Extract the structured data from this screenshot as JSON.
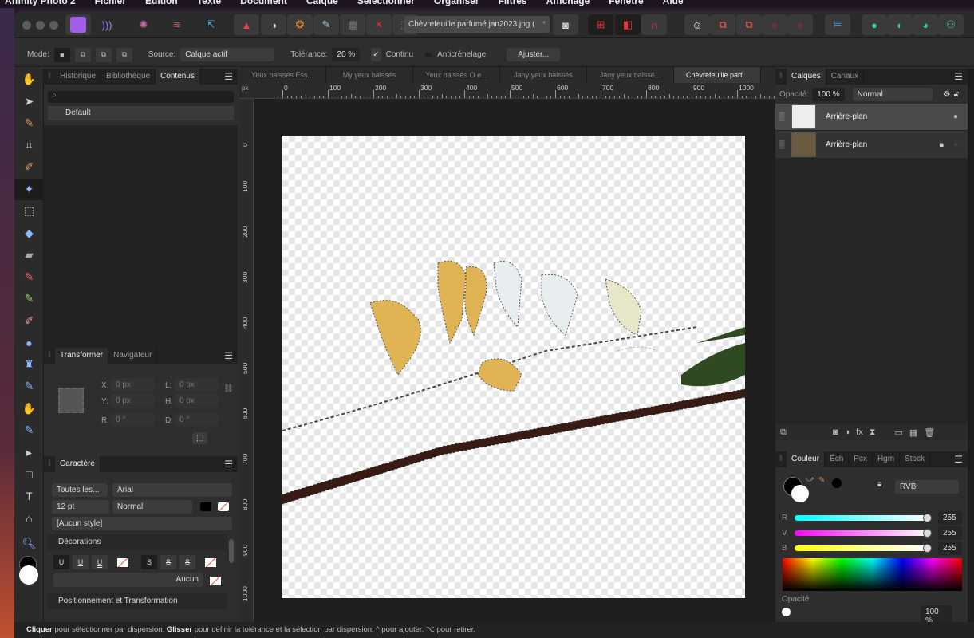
{
  "menubar": [
    "Affinity Photo 2",
    "Fichier",
    "Édition",
    "Texte",
    "Document",
    "Calque",
    "Sélectionner",
    "Organiser",
    "Filtres",
    "Affichage",
    "Fenêtre",
    "Aide"
  ],
  "toolbar": {
    "document_title": "Chèvrefeuille parfumé  jan2023.jpg (",
    "modified_mark": "*"
  },
  "context": {
    "mode_label": "Mode:",
    "source_label": "Source:",
    "source_value": "Calque actif",
    "tolerance_label": "Tolérance:",
    "tolerance_value": "20 %",
    "contiguous_label": "Continu",
    "contiguous_checked": true,
    "antialias_label": "Anticrénelage",
    "antialias_checked": false,
    "adjust_button": "Ajuster..."
  },
  "left_top": {
    "tabs": [
      "Historique",
      "Bibliothèque",
      "Contenus"
    ],
    "active": 2,
    "search_placeholder": "",
    "category": "Default"
  },
  "transform": {
    "tabs": [
      "Transformer",
      "Navigateur"
    ],
    "x_label": "X:",
    "x": "0 px",
    "y_label": "Y:",
    "y": "0 px",
    "w_label": "L:",
    "w": "0 px",
    "h_label": "H:",
    "h": "0 px",
    "r_label": "R:",
    "r": "0 °",
    "s_label": "D:",
    "s": "0 °"
  },
  "character": {
    "tab": "Caractère",
    "collection": "Toutes les...",
    "font": "Arial",
    "size": "12 pt",
    "style": "Normal",
    "para_style": "[Aucun style]",
    "decorations": "Décorations",
    "underline": [
      "U",
      "U",
      "U"
    ],
    "strike": [
      "S",
      "S",
      "S"
    ],
    "none_label": "Aucun",
    "positioning": "Positionnement et Transformation"
  },
  "doc_tabs": [
    "Yeux baissés Ess...",
    "My yeux baissés",
    "Yeux baissés O e...",
    "Jany yeux baissés",
    "Jany yeux baissé...",
    "Chèvrefeuille parf..."
  ],
  "ruler": {
    "unit": "px",
    "h_ticks": [
      "0",
      "100",
      "200",
      "300",
      "400",
      "500",
      "600",
      "700",
      "800",
      "900",
      "1000"
    ],
    "v_ticks": [
      "0",
      "100",
      "200",
      "300",
      "400",
      "500",
      "600",
      "700",
      "800",
      "900",
      "1000"
    ]
  },
  "layers": {
    "tabs": [
      "Calques",
      "Canaux"
    ],
    "opacity_label": "Opacité:",
    "opacity": "100 %",
    "blend": "Normal",
    "items": [
      {
        "name": "Arrière-plan",
        "locked": false,
        "selected": true
      },
      {
        "name": "Arrière-plan",
        "locked": true,
        "selected": false
      }
    ]
  },
  "color": {
    "tabs": [
      "Couleur",
      "Éch",
      "Pcx",
      "Hgm",
      "Stock"
    ],
    "model": "RVB",
    "channels": [
      {
        "label": "R",
        "value": "255"
      },
      {
        "label": "V",
        "value": "255"
      },
      {
        "label": "B",
        "value": "255"
      }
    ],
    "opacity_label": "Opacité",
    "opacity": "100 %"
  },
  "status": {
    "click": "Cliquer",
    "t1": " pour sélectionner par dispersion. ",
    "drag": "Glisser",
    "t2": " pour définir la tolérance et la sélection par dispersion. ^ pour ajouter. ⌥ pour retirer."
  }
}
